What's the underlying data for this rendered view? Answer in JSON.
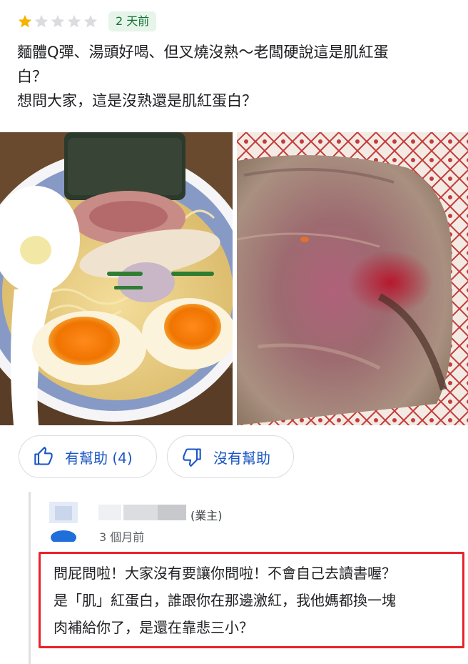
{
  "review": {
    "rating": 1,
    "max_rating": 5,
    "time_badge": "2 天前",
    "text_line1": "麵體Q彈、湯頭好喝、但叉燒沒熟～老闆硬說這是肌紅蛋",
    "text_line2": "白？",
    "text_line3": "想問大家，這是沒熟還是肌紅蛋白？"
  },
  "photos": [
    {
      "icon": "ramen-photo"
    },
    {
      "icon": "chashu-closeup-photo"
    }
  ],
  "actions": {
    "helpful_label": "有幫助 (4)",
    "not_helpful_label": "沒有幫助"
  },
  "owner_reply": {
    "owner_tag": "(業主)",
    "time": "3 個月前",
    "line1": "問屁問啦！大家沒有要讓你問啦！不會自己去讀書喔？",
    "line2": "是「肌」紅蛋白，誰跟你在那邊激紅，我他媽都換一塊",
    "line3": "肉補給你了，是還在靠悲三小？"
  },
  "colors": {
    "star_filled": "#f4b400",
    "star_empty": "#dadce0",
    "badge_bg": "#e6f4ea",
    "badge_text": "#137333",
    "link_blue": "#1a56c4",
    "highlight_red": "#e8232a"
  }
}
